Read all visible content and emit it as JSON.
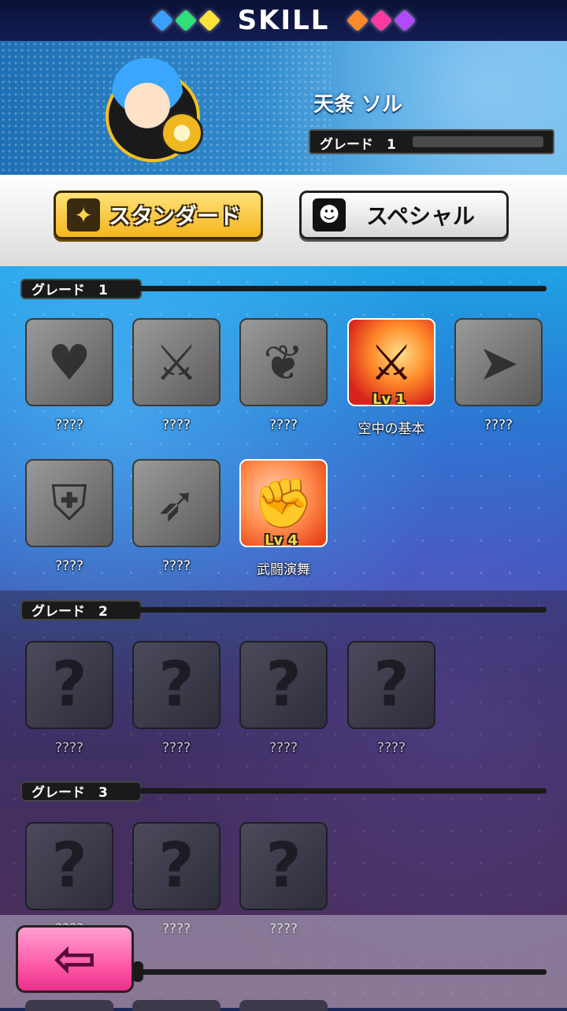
{
  "header": {
    "title": "SKILL",
    "left_gems": [
      "#3aa0ff",
      "#2ee07a",
      "#ffe23a"
    ],
    "right_gems": [
      "#ff8a2a",
      "#ff3aa0",
      "#b04aff"
    ]
  },
  "character": {
    "name": "天条 ソル",
    "grade_label": "グレード　1",
    "grade_progress": 0.0
  },
  "tabs": {
    "standard_label": "スタンダード",
    "special_label": "スペシャル"
  },
  "grades": [
    {
      "label": "グレード　1",
      "skills": [
        {
          "name": "????",
          "icon": "heart-icon",
          "state": "grey",
          "glyph": "♥"
        },
        {
          "name": "????",
          "icon": "sword-attack-icon",
          "state": "grey",
          "glyph": "⚔"
        },
        {
          "name": "????",
          "icon": "herb-timer-icon",
          "state": "grey",
          "glyph": "❦"
        },
        {
          "name": "空中の基本",
          "icon": "aerial-sword-icon",
          "state": "red",
          "glyph": "⚔",
          "level": "Lv 1"
        },
        {
          "name": "????",
          "icon": "dash-arrow-icon",
          "state": "grey",
          "glyph": "➤"
        },
        {
          "name": "????",
          "icon": "runner-shield-icon",
          "state": "grey",
          "glyph": "⛨"
        },
        {
          "name": "????",
          "icon": "bow-timer-icon",
          "state": "grey",
          "glyph": "➶"
        },
        {
          "name": "武闘演舞",
          "icon": "fist-icon",
          "state": "orange",
          "glyph": "✊",
          "level": "Lv 4"
        }
      ]
    },
    {
      "label": "グレード　2",
      "skills": [
        {
          "name": "????",
          "icon": "question-icon",
          "state": "locked",
          "glyph": "?"
        },
        {
          "name": "????",
          "icon": "question-icon",
          "state": "locked",
          "glyph": "?"
        },
        {
          "name": "????",
          "icon": "question-icon",
          "state": "locked",
          "glyph": "?"
        },
        {
          "name": "????",
          "icon": "question-icon",
          "state": "locked",
          "glyph": "?"
        }
      ]
    },
    {
      "label": "グレード　3",
      "skills": [
        {
          "name": "????",
          "icon": "question-icon",
          "state": "locked",
          "glyph": "?"
        },
        {
          "name": "????",
          "icon": "question-icon",
          "state": "locked",
          "glyph": "?"
        },
        {
          "name": "????",
          "icon": "question-icon",
          "state": "locked",
          "glyph": "?"
        }
      ]
    }
  ],
  "back_button": {
    "icon": "back-arrow-icon",
    "glyph": "⇦"
  }
}
